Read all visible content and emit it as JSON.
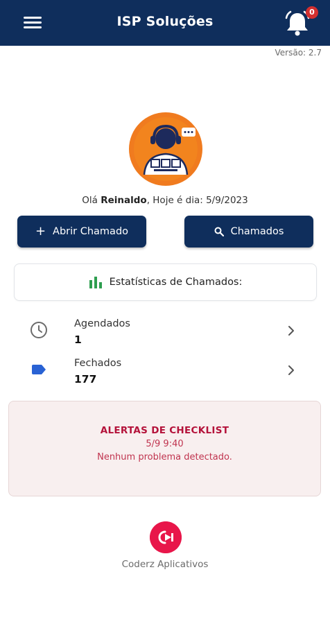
{
  "appbar": {
    "title": "ISP Soluções",
    "menu_icon": "hamburger-menu-icon",
    "bell_icon": "bell-icon",
    "notification_count": "0"
  },
  "version": "Versão: 2.7",
  "greeting": {
    "prefix": "Olá ",
    "name": "Reinaldo",
    "middle": ", Hoje é dia: ",
    "date": "5/9/2023"
  },
  "buttons": {
    "open_ticket": {
      "label": "Abrir Chamado",
      "icon": "plus-icon"
    },
    "tickets": {
      "label": "Chamados",
      "icon": "search-icon"
    }
  },
  "stats": {
    "title": "Estatísticas de Chamados:",
    "icon": "bar-chart-icon",
    "icon_color": "#2e9e4f",
    "items": [
      {
        "label": "Agendados",
        "value": "1",
        "icon": "clock-icon"
      },
      {
        "label": "Fechados",
        "value": "177",
        "icon": "label-tag-icon",
        "icon_color": "#2962d4"
      }
    ]
  },
  "alert": {
    "title": "ALERTAS DE CHECKLIST",
    "time": "5/9 9:40",
    "message": "Nenhum problema detectado.",
    "color": "#b4123a"
  },
  "footer": {
    "brand": "Coderz Aplicativos",
    "brand_color": "#e8164a"
  },
  "colors": {
    "primary": "#0f2e5c",
    "badge": "#d32f2f",
    "avatar_bg": "#f07b1f"
  }
}
